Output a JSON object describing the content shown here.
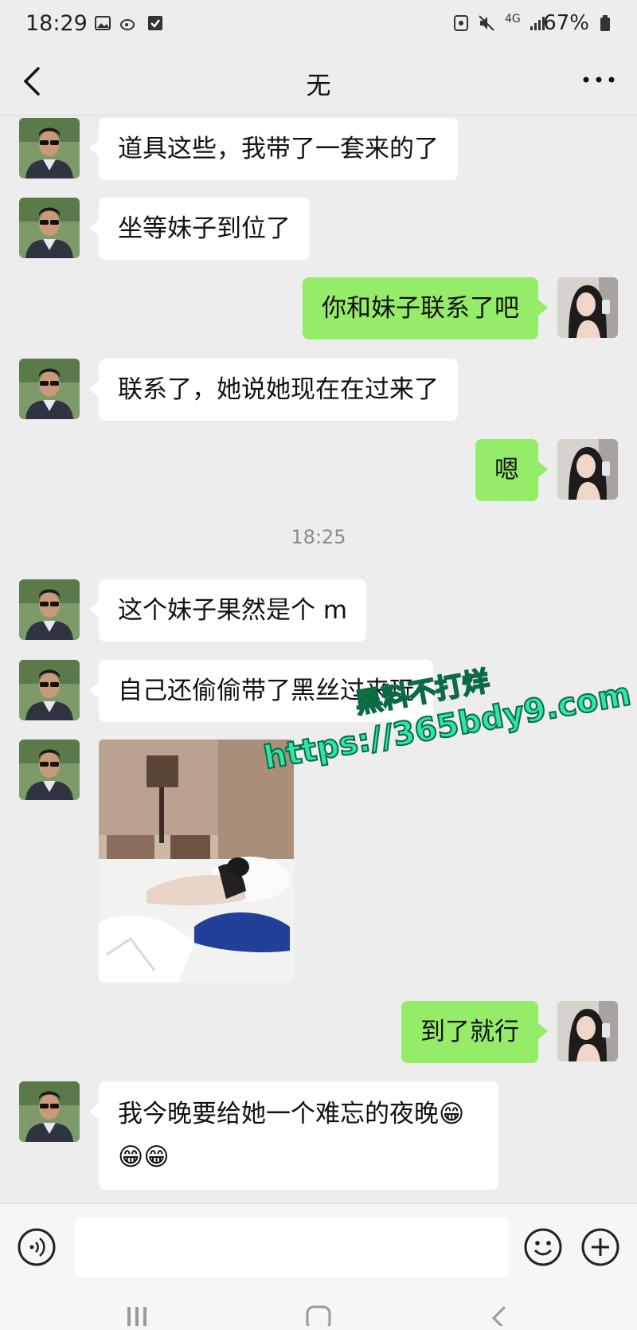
{
  "status_bar": {
    "time": "18:29",
    "signal": "4G",
    "battery": "67%"
  },
  "header": {
    "title": "无",
    "back_icon": "chevron-left-icon",
    "more_icon": "more-horizontal-icon"
  },
  "messages": [
    {
      "side": "in",
      "text": "道具这些，我带了一套来的了"
    },
    {
      "side": "in",
      "text": "坐等妹子到位了"
    },
    {
      "side": "out",
      "text": "你和妹子联系了吧"
    },
    {
      "side": "in",
      "text": "联系了，她说她现在在过来了"
    },
    {
      "side": "out",
      "text": "嗯"
    },
    {
      "side": "in",
      "text": "这个妹子果然是个 m"
    },
    {
      "side": "in",
      "text": "自己还偷偷带了黑丝过来玩"
    },
    {
      "side": "in",
      "type": "image"
    },
    {
      "side": "out",
      "text": "到了就行"
    },
    {
      "side": "in",
      "text": "我今晚要给她一个难忘的夜晚😁",
      "text2": "😁😁"
    }
  ],
  "timestamp": "18:25",
  "watermark": {
    "line1": "黑料不打烊",
    "line2": "https://365bdy9.com"
  },
  "input_bar": {
    "voice_icon": "voice-icon",
    "emoji_icon": "emoji-icon",
    "plus_icon": "plus-icon",
    "placeholder": ""
  },
  "colors": {
    "background": "#ededed",
    "incoming_bubble": "#ffffff",
    "outgoing_bubble": "#95ec69",
    "watermark": "#2fe6a6"
  }
}
